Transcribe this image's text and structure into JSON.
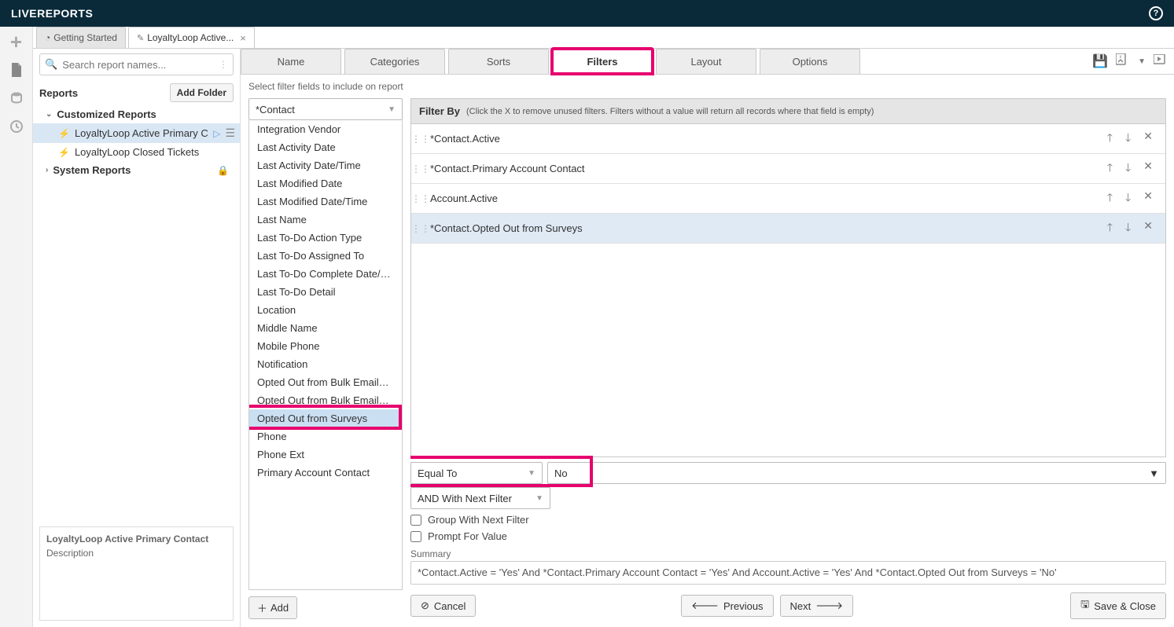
{
  "topbar": {
    "title": "LIVEREPORTS"
  },
  "leftrail": {
    "icons": [
      "plus",
      "file",
      "db",
      "clock"
    ]
  },
  "tabs": [
    {
      "label": "Getting Started",
      "icon": "speed",
      "active": false
    },
    {
      "label": "LoyaltyLoop Active...",
      "icon": "pencil",
      "active": true
    }
  ],
  "search": {
    "placeholder": "Search report names..."
  },
  "reports_label": "Reports",
  "add_folder_label": "Add Folder",
  "tree": {
    "customized": {
      "label": "Customized Reports",
      "items": [
        {
          "label": "LoyaltyLoop Active Primary Con",
          "selected": true
        },
        {
          "label": "LoyaltyLoop Closed Tickets",
          "selected": false
        }
      ]
    },
    "system": {
      "label": "System Reports"
    }
  },
  "desc": {
    "title": "LoyaltyLoop Active Primary Contact",
    "body": "Description"
  },
  "config_tabs": [
    "Name",
    "Categories",
    "Sorts",
    "Filters",
    "Layout",
    "Options"
  ],
  "active_config_tab": "Filters",
  "subhead": "Select filter fields to include on report",
  "contact_dropdown": "*Contact",
  "field_list": [
    "Integration Vendor",
    "Last Activity Date",
    "Last Activity Date/Time",
    "Last Modified Date",
    "Last Modified Date/Time",
    "Last Name",
    "Last To-Do Action Type",
    "Last To-Do Assigned To",
    "Last To-Do Complete Date/Time",
    "Last To-Do Detail",
    "Location",
    "Middle Name",
    "Mobile Phone",
    "Notification",
    "Opted Out from Bulk Emails D...",
    "Opted Out from Bulk Emails D...",
    "Opted Out from Surveys",
    "Phone",
    "Phone Ext",
    "Primary Account Contact"
  ],
  "selected_field_index": 16,
  "add_label": "Add",
  "filter_by": {
    "title": "Filter By",
    "hint": "(Click the X to remove unused filters. Filters without a value will return all records where that field is empty)"
  },
  "filters": [
    {
      "name": "*Contact.Active",
      "selected": false
    },
    {
      "name": "*Contact.Primary Account Contact",
      "selected": false
    },
    {
      "name": "Account.Active",
      "selected": false
    },
    {
      "name": "*Contact.Opted Out from Surveys",
      "selected": true
    }
  ],
  "condition": {
    "op": "Equal To",
    "value": "No",
    "join": "AND With Next Filter"
  },
  "checks": {
    "group": "Group With Next Filter",
    "prompt": "Prompt For Value"
  },
  "summary_label": "Summary",
  "summary_text": "*Contact.Active = 'Yes' And *Contact.Primary Account Contact = 'Yes' And Account.Active = 'Yes' And *Contact.Opted Out from Surveys = 'No'",
  "buttons": {
    "cancel": "Cancel",
    "previous": "Previous",
    "next": "Next",
    "save": "Save & Close"
  }
}
